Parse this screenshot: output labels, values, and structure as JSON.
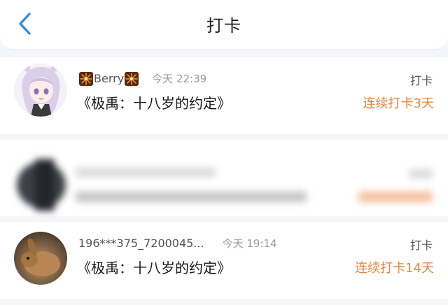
{
  "header": {
    "title": "打卡",
    "back_icon": "chevron-left-icon"
  },
  "accent_color": "#e8843c",
  "items": [
    {
      "username": "Berry",
      "name_decoration_icon": "firework-icon",
      "time": "今天 22:39",
      "book": "《极禹：十八岁的约定》",
      "type": "打卡",
      "streak": "连续打卡3天",
      "avatar_icon": "anime-girl-avatar"
    },
    {
      "blurred": true
    },
    {
      "username": "196***375_7200045...",
      "time": "今天 19:14",
      "book": "《极禹：十八岁的约定》",
      "type": "打卡",
      "streak": "连续打卡14天",
      "avatar_icon": "rabbit-avatar"
    }
  ]
}
